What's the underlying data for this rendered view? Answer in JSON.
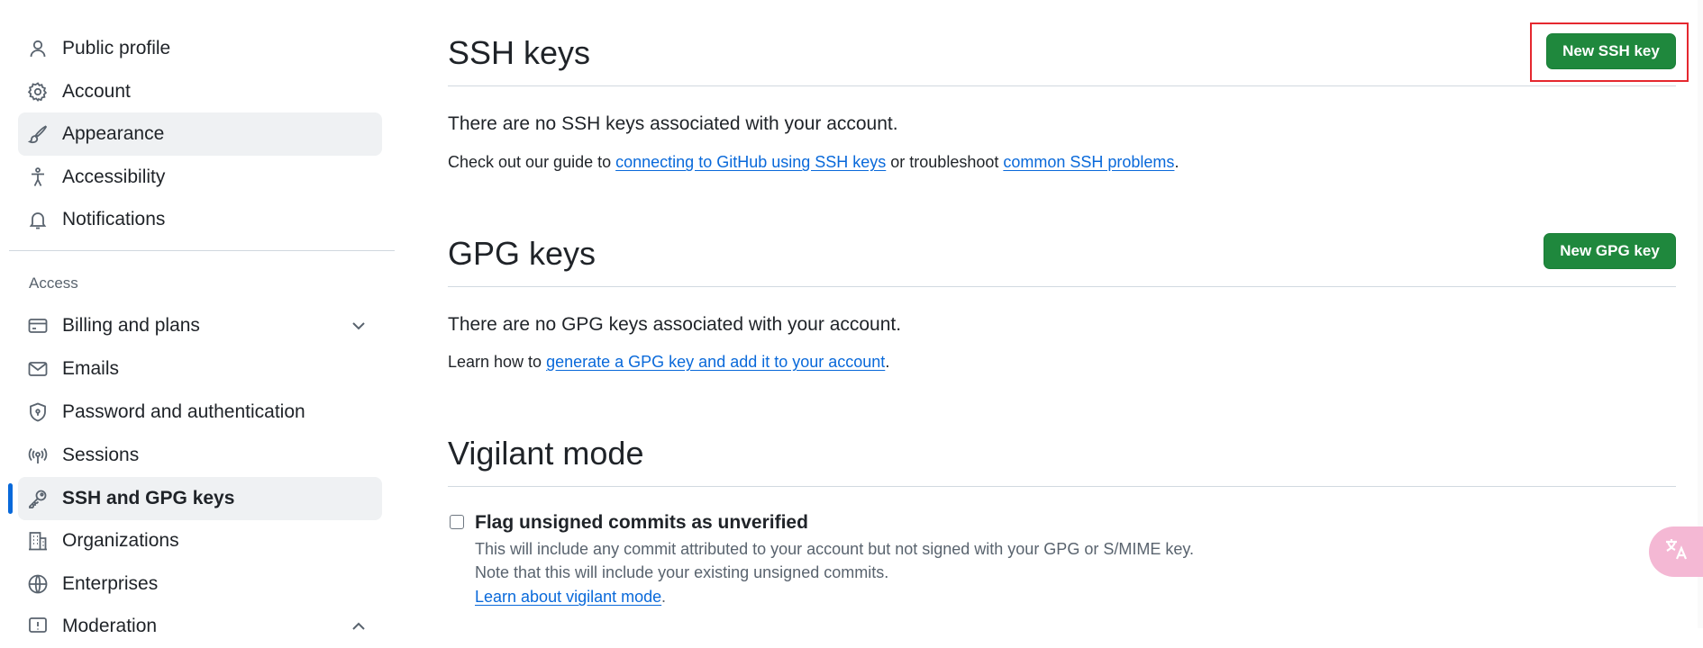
{
  "sidebar": {
    "items": [
      {
        "label": "Public profile",
        "icon": "person-icon"
      },
      {
        "label": "Account",
        "icon": "gear-icon"
      },
      {
        "label": "Appearance",
        "icon": "paintbrush-icon"
      },
      {
        "label": "Accessibility",
        "icon": "accessibility-icon"
      },
      {
        "label": "Notifications",
        "icon": "bell-icon"
      }
    ],
    "access_heading": "Access",
    "access_items": [
      {
        "label": "Billing and plans",
        "icon": "credit-card-icon"
      },
      {
        "label": "Emails",
        "icon": "mail-icon"
      },
      {
        "label": "Password and authentication",
        "icon": "shield-lock-icon"
      },
      {
        "label": "Sessions",
        "icon": "broadcast-icon"
      },
      {
        "label": "SSH and GPG keys",
        "icon": "key-icon"
      },
      {
        "label": "Organizations",
        "icon": "organization-icon"
      },
      {
        "label": "Enterprises",
        "icon": "globe-icon"
      },
      {
        "label": "Moderation",
        "icon": "report-icon"
      }
    ]
  },
  "ssh": {
    "title": "SSH keys",
    "button": "New SSH key",
    "empty": "There are no SSH keys associated with your account.",
    "help_prefix": "Check out our guide to ",
    "help_link1": "connecting to GitHub using SSH keys",
    "help_middle": " or troubleshoot ",
    "help_link2": "common SSH problems",
    "help_suffix": "."
  },
  "gpg": {
    "title": "GPG keys",
    "button": "New GPG key",
    "empty": "There are no GPG keys associated with your account.",
    "help_prefix": "Learn how to ",
    "help_link": "generate a GPG key and add it to your account",
    "help_suffix": "."
  },
  "vigilant": {
    "title": "Vigilant mode",
    "checkbox_label": "Flag unsigned commits as unverified",
    "desc1": "This will include any commit attributed to your account but not signed with your GPG or S/MIME key.",
    "desc2": "Note that this will include your existing unsigned commits.",
    "link": "Learn about vigilant mode",
    "link_suffix": "."
  },
  "colors": {
    "primary_button": "#1f883d",
    "link": "#0969da",
    "active_indicator": "#0969da",
    "highlight": "#e5282f"
  },
  "translate_fab": {
    "icon": "translate-icon"
  }
}
